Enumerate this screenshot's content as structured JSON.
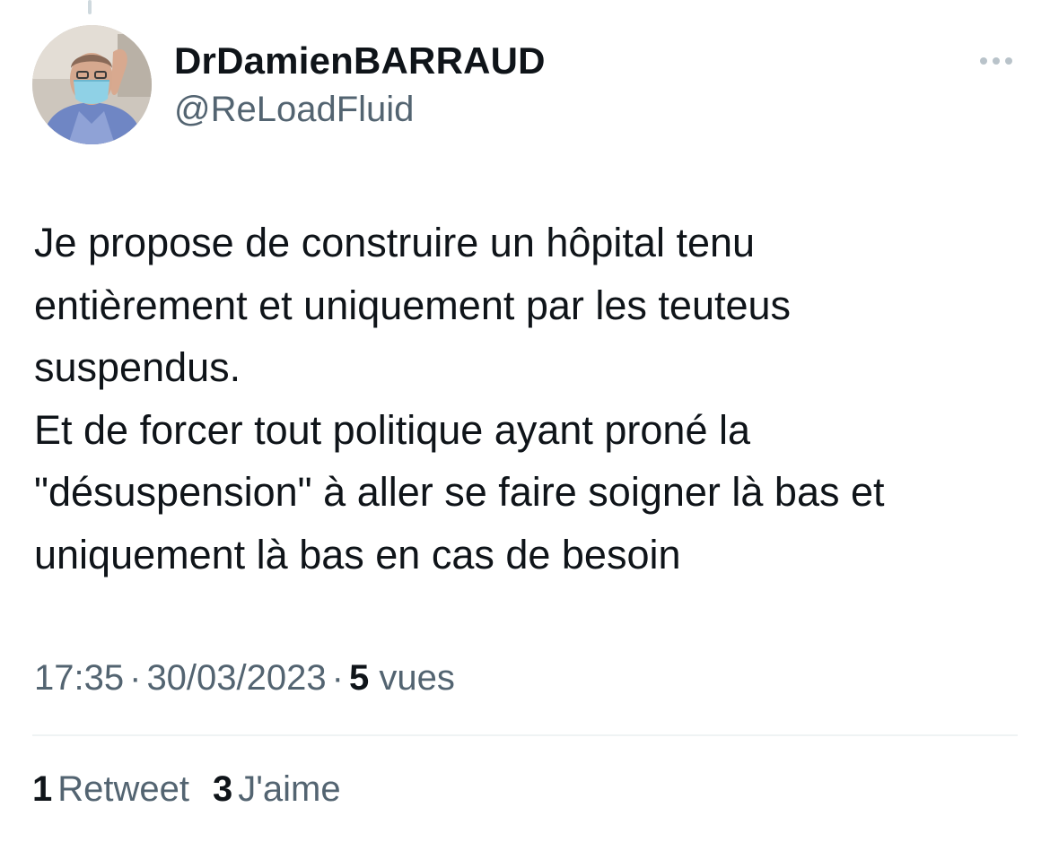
{
  "author": {
    "display_name": "DrDamienBARRAUD",
    "handle": "@ReLoadFluid",
    "avatar_icon": "user-photo-avatar"
  },
  "tweet": {
    "paragraphs": [
      "Je propose de construire un hôpital tenu\nentièrement et uniquement par les teuteus\nsuspendus.",
      "Et de forcer tout politique ayant proné la\n\"désuspension\" à aller se faire soigner là bas et\nuniquement là bas en cas de besoin"
    ]
  },
  "meta": {
    "time": "17:35",
    "separator": "·",
    "date": "30/03/2023",
    "views_count": "5",
    "views_label": "vues"
  },
  "stats": {
    "retweets_count": "1",
    "retweets_label": "Retweet",
    "likes_count": "3",
    "likes_label": "J'aime"
  },
  "icons": {
    "more": "more-horizontal-icon"
  },
  "colors": {
    "text_primary": "#0f1419",
    "text_secondary": "#536471",
    "divider": "#eff3f4",
    "thread_line": "#cfd9de"
  }
}
